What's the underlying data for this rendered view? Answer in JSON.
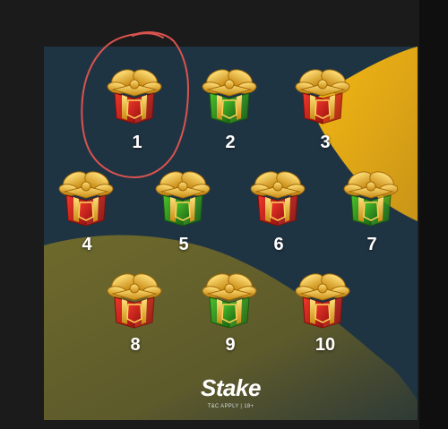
{
  "brand": {
    "logo": "Stake",
    "tagline": "T&C APPLY | 18+"
  },
  "gifts": [
    {
      "number": "1",
      "box_color": "red"
    },
    {
      "number": "2",
      "box_color": "green"
    },
    {
      "number": "3",
      "box_color": "red"
    },
    {
      "number": "4",
      "box_color": "red"
    },
    {
      "number": "5",
      "box_color": "green"
    },
    {
      "number": "6",
      "box_color": "red"
    },
    {
      "number": "7",
      "box_color": "green"
    },
    {
      "number": "8",
      "box_color": "red"
    },
    {
      "number": "9",
      "box_color": "green"
    },
    {
      "number": "10",
      "box_color": "red"
    }
  ],
  "highlighted_gift": "1",
  "colors": {
    "board_bg": "#1f3443",
    "gold_shape": "#f2b01a",
    "olive_shape": "#6b6a2e",
    "highlight_ring": "#d9534f",
    "red_box": "#d8231f",
    "green_box": "#2f9a1e",
    "ribbon_gold": "#e8b330"
  },
  "icons": {
    "gift": "gift-box-icon",
    "annotation": "hand-drawn-circle-icon"
  }
}
